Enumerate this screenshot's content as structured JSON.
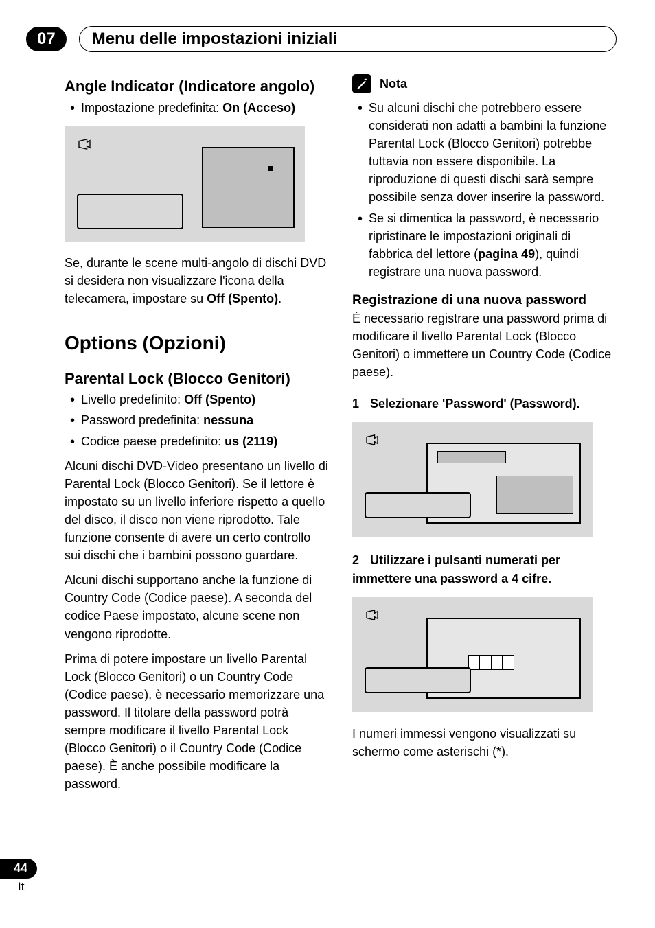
{
  "header": {
    "chapter": "07",
    "title": "Menu delle impostazioni iniziali"
  },
  "left": {
    "h_angle": "Angle Indicator (Indicatore angolo)",
    "bullet_angle_pre": "Impostazione predefinita: ",
    "bullet_angle_bold": "On (Acceso)",
    "p_angle_1": "Se, durante le scene multi-angolo di dischi DVD si desidera non visualizzare l'icona della telecamera, impostare su ",
    "p_angle_1_bold": "Off (Spento)",
    "p_angle_1_after": ".",
    "h_options": "Options (Opzioni)",
    "h_parental": "Parental Lock (Blocco Genitori)",
    "b1_pre": "Livello predefinito: ",
    "b1_bold": "Off (Spento)",
    "b2_pre": "Password predefinita: ",
    "b2_bold": "nessuna",
    "b3_pre": "Codice paese predefinito: ",
    "b3_bold": "us (2119)",
    "p1": "Alcuni dischi DVD-Video presentano un livello di Parental Lock (Blocco Genitori). Se il lettore è impostato su un livello inferiore rispetto a quello del disco, il disco non viene riprodotto. Tale funzione consente di avere un certo controllo sui dischi che i bambini possono guardare.",
    "p2": "Alcuni dischi supportano anche la funzione di Country Code (Codice paese). A seconda del codice Paese impostato, alcune scene non vengono riprodotte.",
    "p3": "Prima di potere impostare un livello Parental Lock (Blocco Genitori) o un Country Code (Codice paese), è necessario memorizzare una password. Il titolare della password potrà sempre modificare il livello Parental Lock (Blocco Genitori) o il Country Code (Codice paese). È anche possibile modificare la password."
  },
  "right": {
    "note_label": "Nota",
    "note_b1": "Su alcuni dischi che potrebbero essere considerati non adatti a bambini la funzione Parental Lock (Blocco Genitori) potrebbe tuttavia non essere disponibile. La riproduzione di questi dischi sarà sempre possibile senza dover inserire la password.",
    "note_b2_pre": "Se si dimentica la password, è necessario ripristinare le impostazioni originali di fabbrica del lettore (",
    "note_b2_bold": "pagina 49",
    "note_b2_after": "), quindi registrare una nuova password.",
    "h_reg": "Registrazione di una nuova password",
    "p_reg": "È necessario registrare una password prima di modificare il livello Parental Lock (Blocco Genitori) o immettere un Country Code (Codice paese).",
    "step1_num": "1",
    "step1": "Selezionare 'Password' (Password).",
    "step2_num": "2",
    "step2": "Utilizzare i pulsanti numerati per immettere una password a 4 cifre.",
    "p_last": "I numeri immessi vengono visualizzati su schermo come asterischi (*)."
  },
  "footer": {
    "page": "44",
    "lang": "It"
  }
}
